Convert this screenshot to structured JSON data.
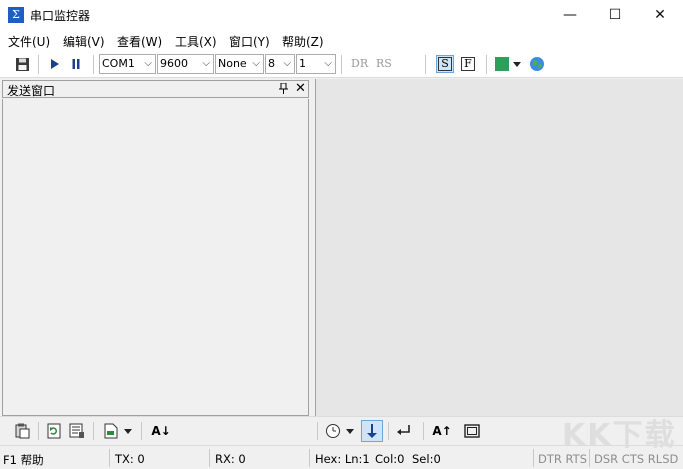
{
  "window": {
    "title": "串口监控器",
    "minimize_glyph": "—",
    "maximize_glyph": "☐",
    "close_glyph": "✕"
  },
  "menu": [
    "文件(U)",
    "编辑(V)",
    "查看(W)",
    "工具(X)",
    "窗口(Y)",
    "帮助(Z)"
  ],
  "toolbar": {
    "port": "COM1",
    "baud": "9600",
    "parity": "None",
    "databits": "8",
    "stopbits": "1",
    "dr_label": "DR",
    "rs_label": "RS",
    "s_label": "S",
    "f_label": "F",
    "accent_color": "#2e9e5b"
  },
  "send_panel": {
    "title": "发送窗口",
    "pin_glyph": "ᅲ",
    "close_glyph": "✕"
  },
  "status": {
    "help": "F1 帮助",
    "tx": "TX: 0",
    "rx": "RX: 0",
    "hex": "Hex: Ln:1",
    "col": "Col:0",
    "sel": "Sel:0",
    "lines1": "DTR RTS",
    "lines2": "DSR CTS RLSD"
  },
  "watermark": "KK下载"
}
